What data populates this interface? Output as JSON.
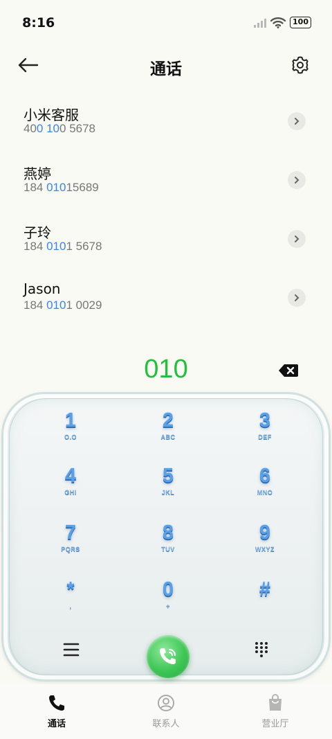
{
  "status_bar": {
    "time": "8:16",
    "battery": "100"
  },
  "header": {
    "title": "通话"
  },
  "contacts": [
    {
      "name": "小米客服",
      "number_parts": [
        "400",
        "",
        " ",
        "100",
        "",
        "0 5678"
      ],
      "segments": [
        {
          "text": "40",
          "hl": false
        },
        {
          "text": "0 10",
          "hl": true
        },
        {
          "text": "0 5678",
          "hl": false
        }
      ]
    },
    {
      "name": "燕婷",
      "segments": [
        {
          "text": "184 ",
          "hl": false
        },
        {
          "text": "010",
          "hl": true
        },
        {
          "text": "15689",
          "hl": false
        }
      ]
    },
    {
      "name": "子玲",
      "segments": [
        {
          "text": "184 ",
          "hl": false
        },
        {
          "text": "010",
          "hl": true
        },
        {
          "text": "1 5678",
          "hl": false
        }
      ]
    },
    {
      "name": "Jason",
      "segments": [
        {
          "text": "184 ",
          "hl": false
        },
        {
          "text": "010",
          "hl": true
        },
        {
          "text": "1 0029",
          "hl": false
        }
      ]
    }
  ],
  "dial": {
    "number": "010"
  },
  "keypad": {
    "keys": [
      {
        "digit": "1",
        "letters": "O.O"
      },
      {
        "digit": "2",
        "letters": "ABC"
      },
      {
        "digit": "3",
        "letters": "DEF"
      },
      {
        "digit": "4",
        "letters": "GHI"
      },
      {
        "digit": "5",
        "letters": "JKL"
      },
      {
        "digit": "6",
        "letters": "MNO"
      },
      {
        "digit": "7",
        "letters": "PQRS"
      },
      {
        "digit": "8",
        "letters": "TUV"
      },
      {
        "digit": "9",
        "letters": "WXYZ"
      },
      {
        "digit": "*",
        "letters": ","
      },
      {
        "digit": "0",
        "letters": "+"
      },
      {
        "digit": "#",
        "letters": ""
      }
    ]
  },
  "bottom_nav": {
    "calls": "通话",
    "contacts": "联系人",
    "store": "营业厅"
  },
  "colors": {
    "accent_green": "#22c03a",
    "highlight_blue": "#3a86e8",
    "key_blue": "#5aa0e6"
  }
}
